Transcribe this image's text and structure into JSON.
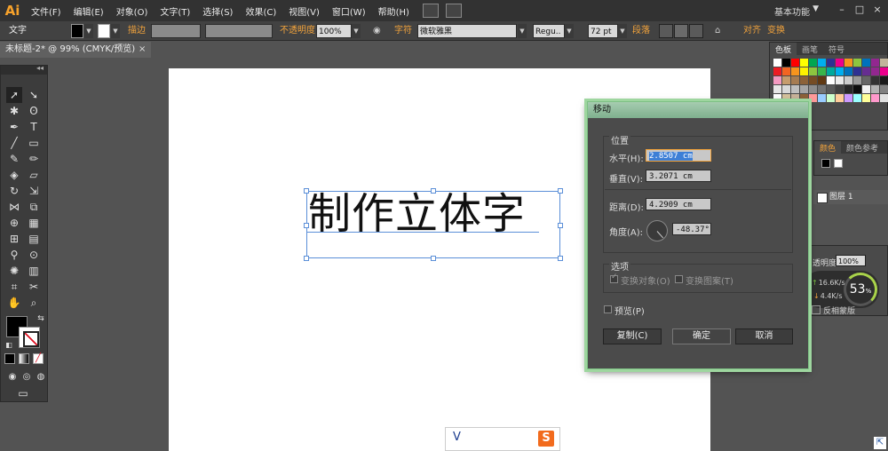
{
  "app": {
    "logo": "Ai",
    "menu": [
      "文件(F)",
      "编辑(E)",
      "对象(O)",
      "文字(T)",
      "选择(S)",
      "效果(C)",
      "视图(V)",
      "窗口(W)",
      "帮助(H)"
    ],
    "workspace": "基本功能",
    "window_buttons": [
      "–",
      "□",
      "×"
    ]
  },
  "control_bar": {
    "mode_label": "文字",
    "stroke_label": "描边",
    "opacity_label": "不透明度",
    "opacity_value": "100%",
    "char_label": "字符",
    "font_name": "微软雅黑",
    "font_style": "Regu..",
    "font_size": "72 pt",
    "para_label": "段落",
    "align_label": "对齐",
    "transform_label": "变换"
  },
  "document": {
    "tab_title": "未标题-2* @ 99% (CMYK/预览)",
    "tab_close": "×"
  },
  "artboard": {
    "text": "制作立体字"
  },
  "ime": {
    "text": "V",
    "logo": "S"
  },
  "panels": {
    "swatch_tabs": [
      "色板",
      "画笔",
      "符号"
    ],
    "color_tabs": [
      "颜色",
      "颜色参考"
    ],
    "layer_name": "图层 1",
    "opacity_label": "透明度",
    "opacity_value": "100%",
    "invert_mask": "反相蒙版",
    "net_up": "16.6K/s",
    "net_down": "4.4K/s",
    "net_percent": "53",
    "net_percent_unit": "%",
    "swatch_colors": [
      "#ffffff",
      "#000000",
      "#ff0000",
      "#ffff00",
      "#00a651",
      "#00aeef",
      "#2e3192",
      "#ec008c",
      "#f7941d",
      "#8dc63f",
      "#0072bc",
      "#92278f",
      "#c2b59b",
      "#998675",
      "#ed1c24",
      "#f26522",
      "#f7941d",
      "#fff200",
      "#8dc63f",
      "#39b54a",
      "#00a99d",
      "#00aeef",
      "#0072bc",
      "#2e3192",
      "#662d91",
      "#92278f",
      "#ec008c",
      "#ed145b",
      "#f49ac1",
      "#c69c6d",
      "#a67c52",
      "#8c6239",
      "#754c24",
      "#603913",
      "#ffffff",
      "#ebebeb",
      "#cccccc",
      "#999999",
      "#666666",
      "#333333",
      "#1a1a1a",
      "#000000",
      "#e6e6e6",
      "#d9d9d9",
      "#bfbfbf",
      "#a6a6a6",
      "#8c8c8c",
      "#737373",
      "#595959",
      "#404040",
      "#262626",
      "#0d0d0d",
      "#f2f2f2",
      "#b3b3b3",
      "#808080",
      "#4d4d4d",
      "#ffffff",
      "#d4c19c",
      "#c7b299",
      "#8c6239",
      "#ff9999",
      "#99ccff",
      "#ccffcc",
      "#ffcc99",
      "#cc99ff",
      "#99ffff",
      "#ffff99",
      "#ff99cc",
      "#e0e0e0",
      "#9e9e9e"
    ]
  },
  "dialog": {
    "title": "移动",
    "position_group": "位置",
    "horizontal_label": "水平(H):",
    "horizontal_value": "2.8507 cm",
    "vertical_label": "垂直(V):",
    "vertical_value": "3.2071 cm",
    "distance_label": "距离(D):",
    "distance_value": "4.2909 cm",
    "angle_label": "角度(A):",
    "angle_value": "-48.37°",
    "options_group": "选项",
    "transform_objects": "变换对象(O)",
    "transform_patterns": "变换图案(T)",
    "preview": "预览(P)",
    "copy_button": "复制(C)",
    "ok_button": "确定",
    "cancel_button": "取消"
  }
}
